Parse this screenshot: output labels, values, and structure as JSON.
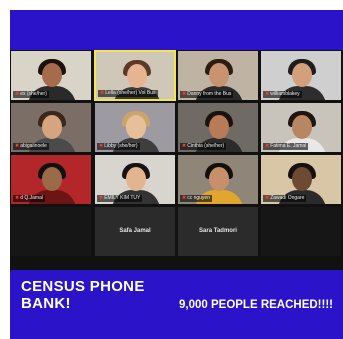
{
  "tiles": [
    {
      "name": "ex (she/her)",
      "colors": {
        "bg": "#d9d4c8",
        "skin": "#a56b4b",
        "hair": "#1b120c",
        "shirt": "#2a2a2a"
      }
    },
    {
      "name": "Lella (she/her) Vol Bus",
      "colors": {
        "bg": "#cfc7b8",
        "skin": "#e6b491",
        "hair": "#5a3a24",
        "shirt": "#3b3b3b"
      },
      "active": true
    },
    {
      "name": "Danny from the Bus",
      "colors": {
        "bg": "#bfb3a4",
        "skin": "#c8946f",
        "hair": "#2c1d13",
        "shirt": "#2a2a2a"
      }
    },
    {
      "name": "williamblakey",
      "colors": {
        "bg": "#cfcfcf",
        "skin": "#d2a07b",
        "hair": "#1d1d1d",
        "shirt": "#2d2d2d"
      }
    },
    {
      "name": "abigaiinoele",
      "colors": {
        "bg": "#7b6e66",
        "skin": "#d6a580",
        "hair": "#3a261a",
        "shirt": "#4b4b4b"
      }
    },
    {
      "name": "Libby (she/her)",
      "colors": {
        "bg": "#9d9aa1",
        "skin": "#e7bf9b",
        "hair": "#c9a56b",
        "shirt": "#3e3e3e"
      }
    },
    {
      "name": "Cinthia (she/her)",
      "colors": {
        "bg": "#6f6a64",
        "skin": "#b87b58",
        "hair": "#1c120c",
        "shirt": "#2b2b2b"
      }
    },
    {
      "name": "Fatima E. Jamal",
      "colors": {
        "bg": "#c8c3bb",
        "skin": "#b98662",
        "hair": "#1f1510",
        "shirt": "#e8e8e8"
      }
    },
    {
      "name": "d Q.Jamal",
      "colors": {
        "bg": "#b3262a",
        "skin": "#9a6a49",
        "hair": "#111111",
        "shirt": "#6b1515"
      }
    },
    {
      "name": "EMILY KIM TUY",
      "colors": {
        "bg": "#d8d5cf",
        "skin": "#e2b48f",
        "hair": "#181210",
        "shirt": "#333333"
      }
    },
    {
      "name": "cc nguyen",
      "colors": {
        "bg": "#8f8579",
        "skin": "#c6916a",
        "hair": "#150f0b",
        "shirt": "#e0a62e"
      }
    },
    {
      "name": "Zawadi Ongare",
      "colors": {
        "bg": "#d8c6a7",
        "skin": "#6e4a32",
        "hair": "#161110",
        "shirt": "#2b2b2b"
      }
    },
    {
      "name": "",
      "colors": {
        "bg": "#161616"
      },
      "empty": true
    },
    {
      "name": "Safa Jamal",
      "colors": {
        "bg": "#2b2b2b"
      },
      "nameOnly": true
    },
    {
      "name": "Sara Tadmori",
      "colors": {
        "bg": "#2b2b2b"
      },
      "nameOnly": true
    },
    {
      "name": "",
      "colors": {
        "bg": "#161616"
      },
      "empty": true
    }
  ],
  "banner": {
    "headline": "CENSUS PHONE BANK!",
    "reach": "9,000 PEOPLE REACHED!!!!"
  },
  "colors": {
    "frame": "#2a13c9",
    "activeBorder": "#f2e64a",
    "mutedMic": "#ff3b30"
  }
}
